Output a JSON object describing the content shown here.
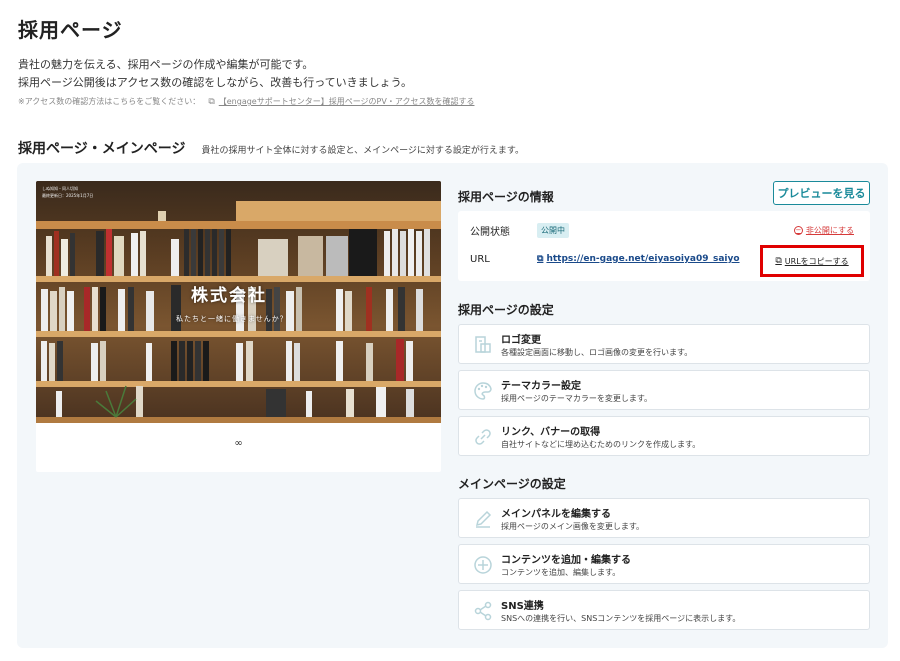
{
  "page": {
    "title": "採用ページ",
    "desc_line1": "貴社の魅力を伝える、採用ページの作成や編集が可能です。",
    "desc_line2": "採用ページ公開後はアクセス数の確認をしながら、改善も行っていきましょう。",
    "note_text": "※アクセス数の確認方法はこちらをご覧ください：",
    "note_link": "【engageサポートセンター】採用ページのPV・アクセス数を確認する"
  },
  "section": {
    "title": "採用ページ・メインページ",
    "subtitle": "貴社の採用サイト全体に対する設定と、メインページに対する設定が行えます。"
  },
  "preview": {
    "top_text1": "しぬ知知・同人切知",
    "top_text2": "最終更新日：2025年1月7日",
    "company_name": "株式会社",
    "tagline": "私たちと一緒に働きませんか？",
    "footer_mark": "∞"
  },
  "info": {
    "title": "採用ページの情報",
    "preview_button": "プレビューを見る",
    "status_label": "公開状態",
    "status_badge": "公開中",
    "unpublish_link": "非公開にする",
    "url_label": "URL",
    "url_value": "https://en-gage.net/eiyasoiya09_saiyo",
    "copy_button": "URLをコピーする"
  },
  "settings": {
    "title": "採用ページの設定",
    "items": [
      {
        "title": "ロゴ変更",
        "desc": "各種設定画面に移動し、ロゴ画像の変更を行います。",
        "icon": "logo-icon"
      },
      {
        "title": "テーマカラー設定",
        "desc": "採用ページのテーマカラーを変更します。",
        "icon": "palette-icon"
      },
      {
        "title": "リンク、バナーの取得",
        "desc": "自社サイトなどに埋め込むためのリンクを作成します。",
        "icon": "link-icon"
      }
    ]
  },
  "main_settings": {
    "title": "メインページの設定",
    "items": [
      {
        "title": "メインパネルを編集する",
        "desc": "採用ページのメイン画像を変更します。",
        "icon": "pencil-icon"
      },
      {
        "title": "コンテンツを追加・編集する",
        "desc": "コンテンツを追加、編集します。",
        "icon": "plus-circle-icon"
      },
      {
        "title": "SNS連携",
        "desc": "SNSへの連携を行い、SNSコンテンツを採用ページに表示します。",
        "icon": "share-icon"
      }
    ]
  },
  "colors": {
    "accent": "#1a8a9a",
    "danger": "#d63a3a",
    "highlight": "#e00000",
    "panel_bg": "#f3f7fa"
  }
}
